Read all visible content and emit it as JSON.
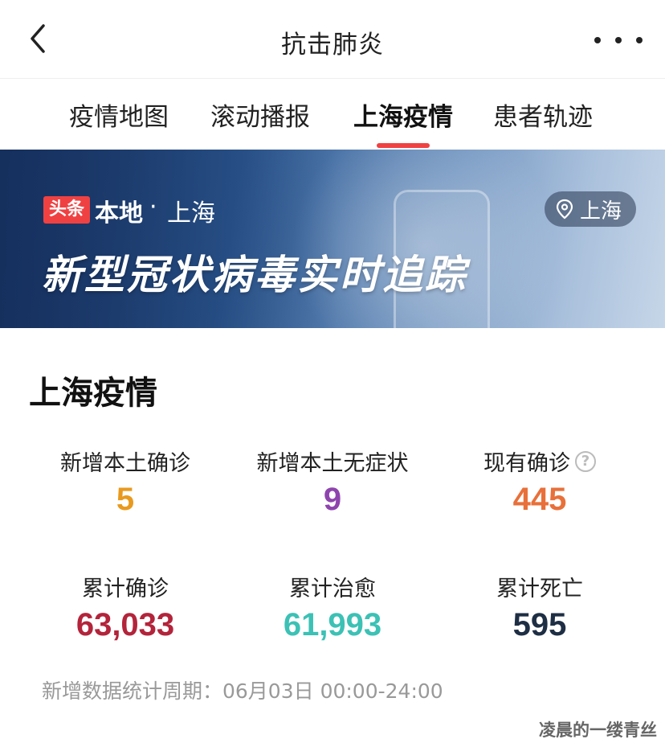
{
  "header": {
    "title": "抗击肺炎"
  },
  "tabs": [
    {
      "label": "疫情地图",
      "active": false
    },
    {
      "label": "滚动播报",
      "active": false
    },
    {
      "label": "上海疫情",
      "active": true
    },
    {
      "label": "患者轨迹",
      "active": false
    }
  ],
  "banner": {
    "badge": "头条",
    "local_label": "本地",
    "separator": "·",
    "city": "上海",
    "location_chip": "上海",
    "headline": "新型冠状病毒实时追踪"
  },
  "section": {
    "title": "上海疫情"
  },
  "stats": [
    {
      "label": "新增本土确诊",
      "value": "5",
      "color": "#e89a1f"
    },
    {
      "label": "新增本土无症状",
      "value": "9",
      "color": "#8e44ad"
    },
    {
      "label": "现有确诊",
      "value": "445",
      "color": "#e8703a"
    },
    {
      "label": "累计确诊",
      "value": "63,033",
      "color": "#b3243b"
    },
    {
      "label": "累计治愈",
      "value": "61,993",
      "color": "#3cc1b5"
    },
    {
      "label": "累计死亡",
      "value": "595",
      "color": "#1e2e44"
    }
  ],
  "footnote": "新增数据统计周期：06月03日 00:00-24:00",
  "watermark": "凌晨的一缕青丝",
  "colors": {
    "accent": "#f04142"
  }
}
